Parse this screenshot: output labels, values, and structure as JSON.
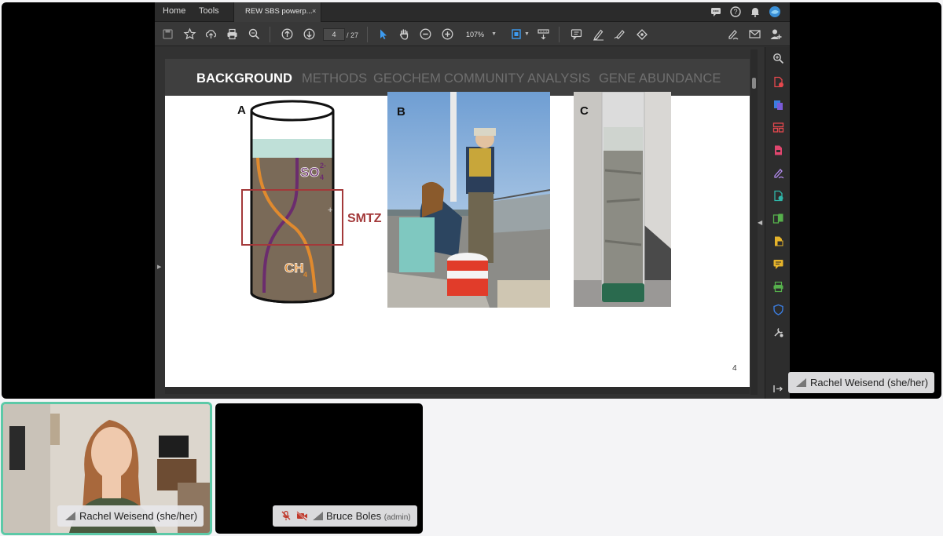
{
  "acrobat": {
    "menu": {
      "home": "Home",
      "tools": "Tools"
    },
    "tab": {
      "title": "REW SBS powerp...",
      "close": "×"
    },
    "toolbar": {
      "page_current": "4",
      "page_total": "/ 27",
      "zoom": "107%"
    }
  },
  "slide": {
    "nav": [
      "BACKGROUND",
      "METHODS",
      "GEOCHEM",
      "COMMUNITY ANALYSIS",
      "GENE ABUNDANCE"
    ],
    "active_nav": "BACKGROUND",
    "panel_labels": [
      "A",
      "B",
      "C"
    ],
    "diagram": {
      "so4_label": "SO",
      "so4_sup": "2-",
      "so4_sub": "4",
      "ch4_label": "CH",
      "ch4_sub": "4",
      "smtz_label": "SMTZ"
    },
    "page_number": "4"
  },
  "participants": {
    "presenter_badge": "Rachel Weisend (she/her)",
    "tile1_name": "Rachel Weisend (she/her)",
    "tile2_name": "Bruce Boles",
    "tile2_role": "(admin)"
  },
  "colors": {
    "speaker_border": "#5cc9a7",
    "sediment": "#7a6a58",
    "water": "#bfe0d8",
    "smtz_box": "#a3393a",
    "sulfate_line": "#6b2c6e",
    "methane_line": "#e08a2e"
  }
}
